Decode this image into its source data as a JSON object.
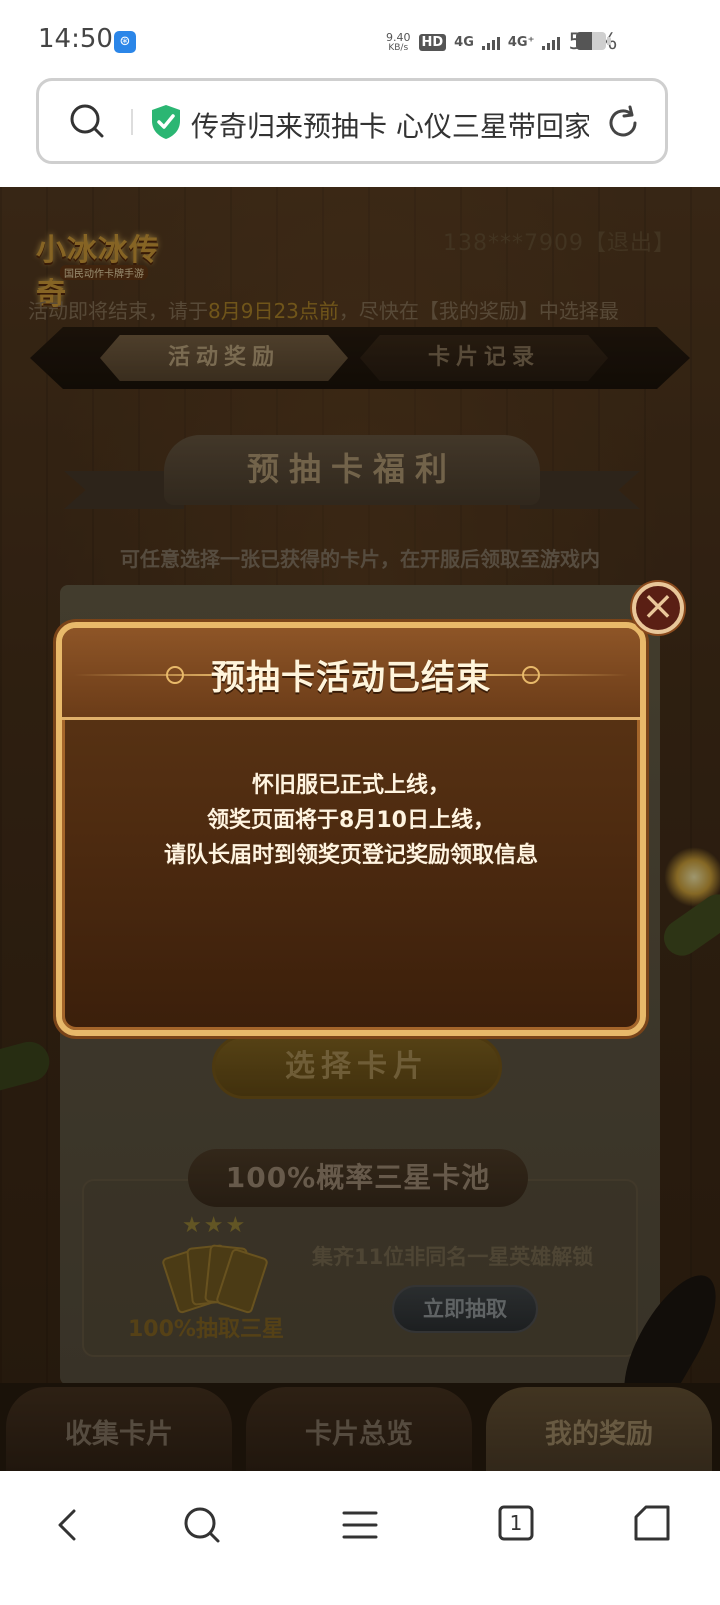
{
  "status_bar": {
    "time": "14:50",
    "app_icon": "browser-app-icon",
    "speed_value": "9.40",
    "speed_unit": "KB/s",
    "hd": "HD",
    "net1": "4G",
    "net2": "4G⁺",
    "battery_pct": "53%",
    "battery_level": 0.53
  },
  "address_bar": {
    "title": "传奇归来预抽卡 心仪三星带回家"
  },
  "game": {
    "logo_text": "小冰冰传奇",
    "logo_sub": "国民动作卡牌手游",
    "user": "138***7909【退出】",
    "notice_before": "活动即将结束，请于",
    "notice_highlight": "8月9日23点前",
    "notice_after": "，尽快在【我的奖励】中选择最",
    "tab_rewards": "活动奖励",
    "tab_records": "卡片记录",
    "banner_title": "预抽卡福利",
    "subtitle": "可任意选择一张已获得的卡片，在开服后领取至游戏内",
    "select_card": "选择卡片",
    "pool_title": "100%概率三星卡池",
    "stars": "★★★",
    "draw_three": "100%抽取三星",
    "unlock_text": "集齐11位非同名一星英雄解锁",
    "draw_now": "立即抽取",
    "bottom_tabs": [
      "收集卡片",
      "卡片总览",
      "我的奖励"
    ]
  },
  "modal": {
    "title": "预抽卡活动已结束",
    "line1": "怀旧服已正式上线，",
    "line2": "领奖页面将于8月10日上线，",
    "line3": "请队长届时到领奖页登记奖励领取信息"
  },
  "bottom_nav": {
    "tabs_count": "1"
  }
}
